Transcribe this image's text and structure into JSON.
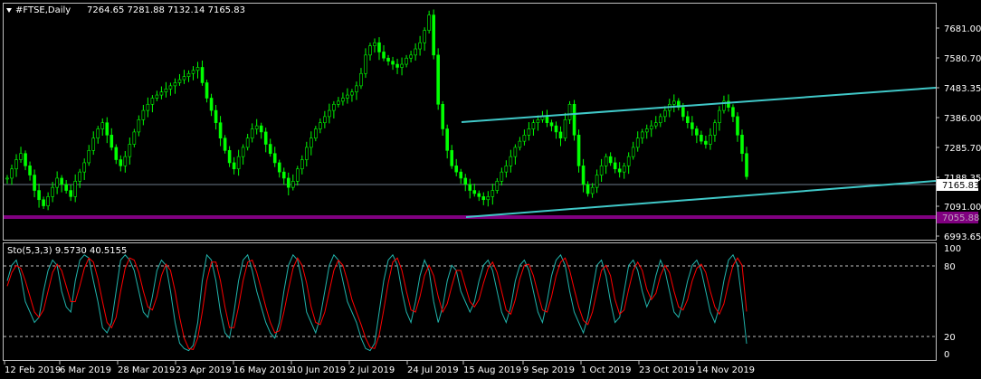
{
  "main": {
    "symbol": "#FTSE,Daily",
    "ohlc": "7264.65 7281.88 7132.14 7165.83",
    "yticks": [
      "7681.00",
      "7580.70",
      "7483.35",
      "7386.00",
      "7285.70",
      "7188.35",
      "7091.00",
      "6993.65"
    ],
    "current_price": "7165.83",
    "hline_price": "7055.88"
  },
  "indicator": {
    "title": "Sto(5,3,3) 9.5730 40.5155",
    "yticks": [
      "100",
      "80",
      "20",
      "0"
    ]
  },
  "xaxis": {
    "labels": [
      "12 Feb 2019",
      "6 Mar 2019",
      "28 Mar 2019",
      "23 Apr 2019",
      "16 May 2019",
      "10 Jun 2019",
      "2 Jul 2019",
      "24 Jul 2019",
      "15 Aug 2019",
      "9 Sep 2019",
      "1 Oct 2019",
      "23 Oct 2019",
      "14 Nov 2019"
    ]
  },
  "colors": {
    "background": "#000000",
    "candle": "#00ff00",
    "channel": "#40c8c8",
    "hline": "#800080",
    "stoch_main": "#20b2aa",
    "stoch_signal": "#ff0000",
    "grid": "#c0c0c0"
  },
  "chart_data": [
    {
      "type": "candlestick",
      "title": "#FTSE,Daily",
      "ylim": [
        6960,
        7730
      ],
      "close": [
        7160,
        7190,
        7220,
        7240,
        7200,
        7170,
        7120,
        7090,
        7070,
        7100,
        7130,
        7160,
        7140,
        7120,
        7100,
        7150,
        7180,
        7210,
        7250,
        7290,
        7320,
        7340,
        7300,
        7260,
        7220,
        7200,
        7230,
        7270,
        7310,
        7350,
        7380,
        7400,
        7420,
        7430,
        7440,
        7450,
        7460,
        7470,
        7480,
        7490,
        7500,
        7510,
        7520,
        7470,
        7420,
        7380,
        7340,
        7290,
        7250,
        7210,
        7190,
        7230,
        7260,
        7290,
        7320,
        7330,
        7310,
        7270,
        7240,
        7210,
        7180,
        7160,
        7130,
        7150,
        7190,
        7220,
        7260,
        7290,
        7320,
        7340,
        7360,
        7380,
        7400,
        7410,
        7420,
        7430,
        7440,
        7460,
        7500,
        7560,
        7590,
        7600,
        7570,
        7550,
        7540,
        7530,
        7520,
        7530,
        7550,
        7560,
        7580,
        7600,
        7640,
        7690,
        7560,
        7400,
        7320,
        7250,
        7200,
        7180,
        7160,
        7140,
        7120,
        7110,
        7100,
        7090,
        7100,
        7120,
        7150,
        7180,
        7200,
        7230,
        7260,
        7280,
        7300,
        7320,
        7340,
        7350,
        7360,
        7340,
        7330,
        7310,
        7290,
        7350,
        7400,
        7300,
        7200,
        7140,
        7110,
        7130,
        7170,
        7200,
        7230,
        7210,
        7190,
        7180,
        7200,
        7230,
        7260,
        7290,
        7310,
        7320,
        7330,
        7340,
        7360,
        7380,
        7400,
        7410,
        7390,
        7360,
        7340,
        7320,
        7300,
        7280,
        7270,
        7300,
        7340,
        7380,
        7410,
        7390,
        7360,
        7300,
        7240,
        7165
      ],
      "channel_upper": [
        [
          7375,
          7490
        ]
      ],
      "channel_lower": [
        [
          7065,
          7178
        ]
      ],
      "hline": 7055.88
    },
    {
      "type": "line",
      "title": "Sto(5,3,3)",
      "ylim": [
        0,
        100
      ],
      "levels": [
        20,
        80
      ],
      "series": [
        {
          "name": "main",
          "values": [
            70,
            85,
            90,
            75,
            50,
            40,
            30,
            35,
            60,
            80,
            90,
            85,
            60,
            45,
            40,
            70,
            90,
            95,
            92,
            70,
            50,
            25,
            20,
            30,
            60,
            90,
            95,
            90,
            80,
            60,
            40,
            35,
            55,
            80,
            90,
            85,
            60,
            30,
            10,
            5,
            3,
            8,
            30,
            70,
            95,
            90,
            70,
            40,
            20,
            15,
            40,
            70,
            90,
            95,
            80,
            60,
            45,
            30,
            20,
            15,
            30,
            60,
            85,
            95,
            90,
            70,
            40,
            30,
            20,
            35,
            60,
            85,
            95,
            90,
            70,
            50,
            40,
            30,
            15,
            5,
            3,
            10,
            40,
            70,
            90,
            95,
            85,
            60,
            40,
            30,
            50,
            75,
            90,
            80,
            50,
            30,
            45,
            70,
            85,
            80,
            60,
            50,
            40,
            50,
            70,
            85,
            90,
            80,
            60,
            40,
            30,
            45,
            70,
            85,
            90,
            80,
            60,
            40,
            30,
            50,
            75,
            90,
            95,
            85,
            60,
            40,
            30,
            20,
            35,
            60,
            85,
            90,
            75,
            50,
            30,
            35,
            60,
            85,
            90,
            80,
            60,
            45,
            55,
            75,
            90,
            80,
            60,
            40,
            35,
            50,
            70,
            85,
            90,
            80,
            60,
            40,
            30,
            45,
            70,
            90,
            95,
            85,
            50,
            9.573
          ]
        },
        {
          "name": "signal",
          "values": [
            65,
            78,
            85,
            82,
            70,
            55,
            40,
            35,
            42,
            60,
            78,
            86,
            80,
            65,
            50,
            50,
            65,
            82,
            92,
            88,
            72,
            50,
            30,
            25,
            35,
            60,
            82,
            92,
            90,
            78,
            60,
            45,
            42,
            55,
            75,
            86,
            80,
            60,
            35,
            15,
            5,
            4,
            15,
            40,
            70,
            88,
            88,
            70,
            45,
            25,
            25,
            45,
            70,
            88,
            90,
            78,
            62,
            45,
            30,
            20,
            22,
            40,
            62,
            82,
            92,
            85,
            68,
            45,
            30,
            28,
            40,
            60,
            80,
            90,
            85,
            70,
            52,
            40,
            28,
            15,
            6,
            5,
            18,
            42,
            68,
            88,
            92,
            80,
            60,
            42,
            40,
            55,
            75,
            85,
            75,
            55,
            40,
            48,
            65,
            80,
            80,
            65,
            50,
            45,
            52,
            68,
            82,
            88,
            78,
            60,
            42,
            38,
            52,
            72,
            85,
            86,
            75,
            58,
            42,
            40,
            55,
            75,
            88,
            92,
            80,
            62,
            45,
            32,
            28,
            40,
            60,
            80,
            85,
            75,
            52,
            38,
            42,
            62,
            80,
            88,
            80,
            62,
            52,
            58,
            75,
            85,
            78,
            60,
            45,
            42,
            52,
            70,
            82,
            86,
            78,
            60,
            45,
            38,
            48,
            68,
            85,
            92,
            85,
            40.5155
          ]
        }
      ]
    }
  ]
}
